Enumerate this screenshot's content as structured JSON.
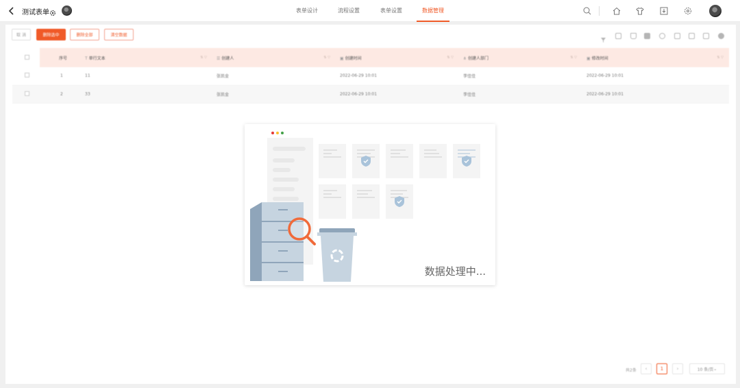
{
  "header": {
    "title": "测试表单",
    "tabs": [
      {
        "label": "表单设计",
        "active": false
      },
      {
        "label": "流程设置",
        "active": false
      },
      {
        "label": "表单设置",
        "active": false
      },
      {
        "label": "数据管理",
        "active": true
      }
    ],
    "tools": [
      "search-icon",
      "home-icon",
      "shirt-icon",
      "download-icon",
      "settings-icon"
    ],
    "accent_color": "#f05a28"
  },
  "toolbar": {
    "cancel_label": "取 消",
    "delete_selected_label": "删除选中",
    "delete_all_label": "删除全部",
    "clear_data_label": "清空数据"
  },
  "right_tools": [
    "filter-icon",
    "calendar-icon",
    "trash-icon",
    "bin-icon",
    "eye-icon",
    "import-icon",
    "export-icon",
    "layout-icon",
    "settings-icon"
  ],
  "table": {
    "columns": [
      "序号",
      "单行文本",
      "创建人",
      "创建时间",
      "创建人部门",
      "修改时间"
    ],
    "rows": [
      {
        "index": "1",
        "text": "11",
        "creator": "张凯金",
        "created": "2022-06-29 10:01",
        "dept": "李佳佳",
        "modified": "2022-06-29 10:01"
      },
      {
        "index": "2",
        "text": "33",
        "creator": "张凯金",
        "created": "2022-06-29 10:01",
        "dept": "李佳佳",
        "modified": "2022-06-29 10:01"
      }
    ]
  },
  "overlay": {
    "status_text": "数据处理中..."
  },
  "pagination": {
    "total_label": "共2条",
    "current_page": "1",
    "page_size_label": "10 条/页"
  }
}
